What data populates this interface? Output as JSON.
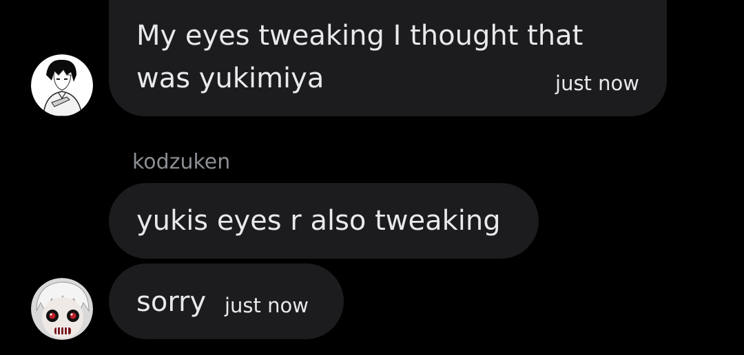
{
  "conversation": {
    "messages": [
      {
        "lines": [
          "My eyes tweaking I thought that",
          "was yukimiya"
        ],
        "time": "just now"
      },
      {
        "sender": "kodzuken",
        "text": "yukis eyes r also tweaking"
      },
      {
        "text": "sorry",
        "time": "just now"
      }
    ]
  },
  "colors": {
    "background": "#000000",
    "bubble": "#1c1c1e",
    "text": "#e7e9ea",
    "sender": "#8b8f93"
  }
}
